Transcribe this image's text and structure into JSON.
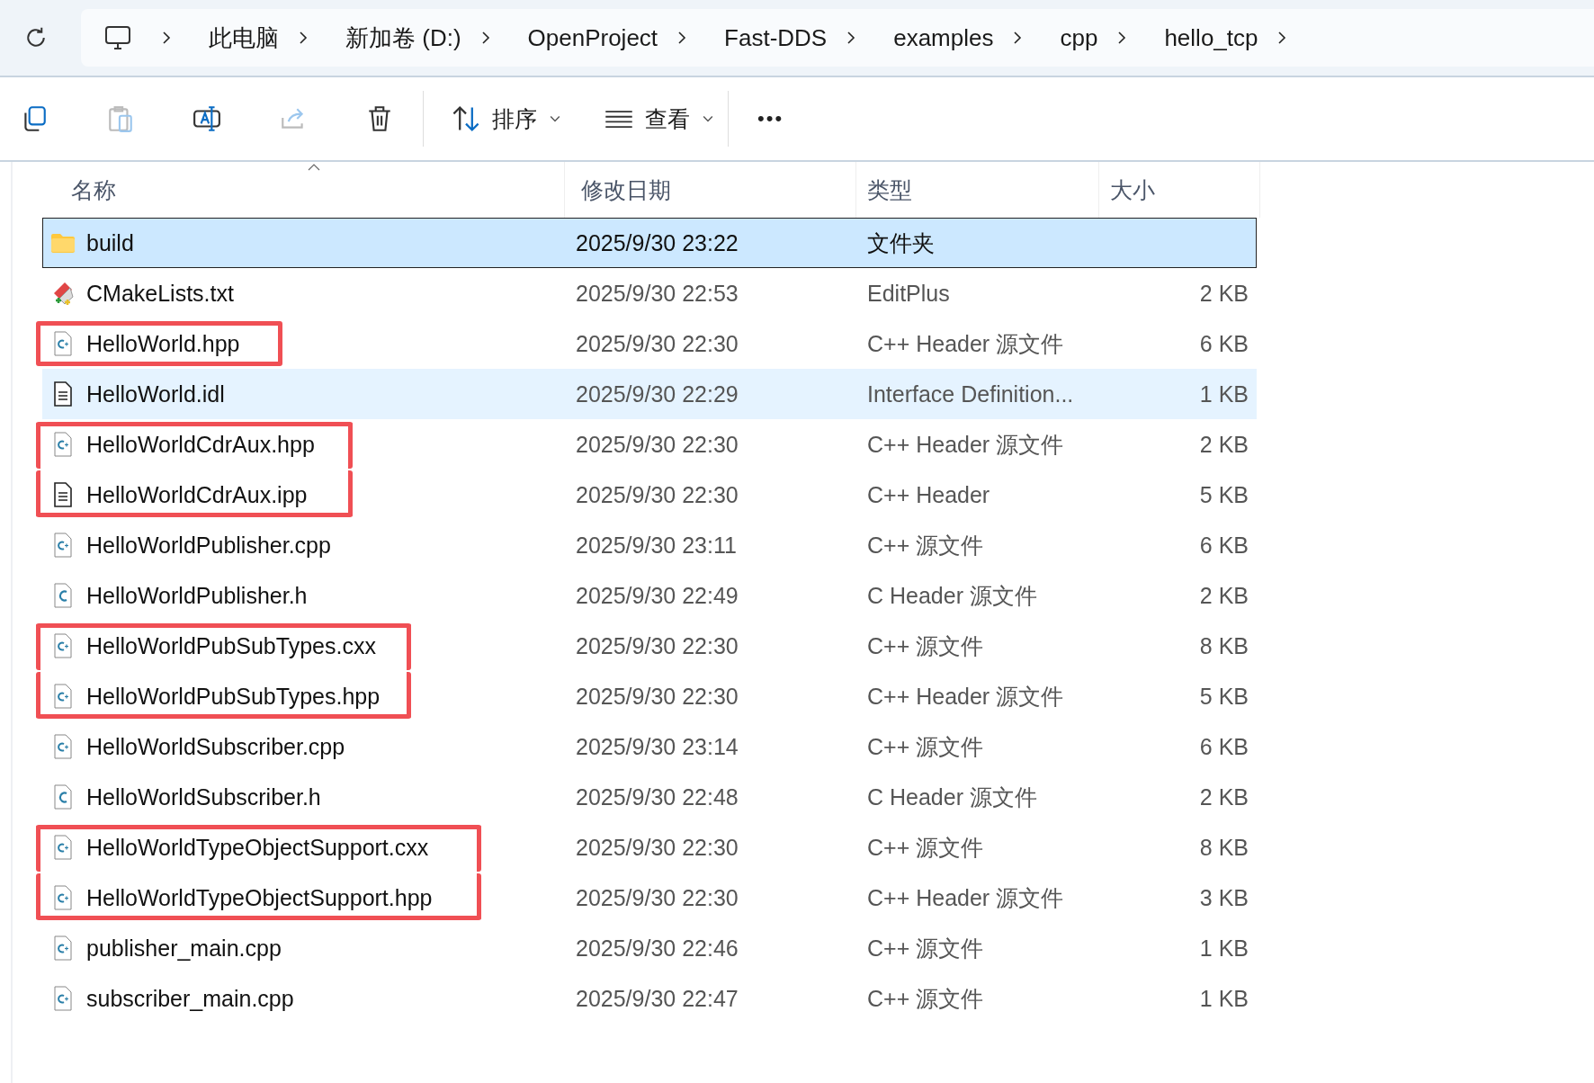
{
  "breadcrumb": [
    "此电脑",
    "新加卷 (D:)",
    "OpenProject",
    "Fast-DDS",
    "examples",
    "cpp",
    "hello_tcp"
  ],
  "toolbar": {
    "sort_label": "排序",
    "view_label": "查看",
    "more_label": "•••"
  },
  "columns": [
    "名称",
    "修改日期",
    "类型",
    "大小"
  ],
  "rows": [
    {
      "name": "build",
      "date": "2025/9/30 23:22",
      "type": "文件夹",
      "size": "",
      "kind": "folder",
      "selected": true,
      "hovered": false,
      "marked": false
    },
    {
      "name": "CMakeLists.txt",
      "date": "2025/9/30 22:53",
      "type": "EditPlus",
      "size": "2 KB",
      "kind": "editplus",
      "selected": false,
      "hovered": false,
      "marked": false
    },
    {
      "name": "HelloWorld.hpp",
      "date": "2025/9/30 22:30",
      "type": "C++ Header 源文件",
      "size": "6 KB",
      "kind": "cpp",
      "selected": false,
      "hovered": false,
      "marked": true
    },
    {
      "name": "HelloWorld.idl",
      "date": "2025/9/30 22:29",
      "type": "Interface Definition...",
      "size": "1 KB",
      "kind": "doc",
      "selected": false,
      "hovered": true,
      "marked": false
    },
    {
      "name": "HelloWorldCdrAux.hpp",
      "date": "2025/9/30 22:30",
      "type": "C++ Header 源文件",
      "size": "2 KB",
      "kind": "cpp",
      "selected": false,
      "hovered": false,
      "marked": true
    },
    {
      "name": "HelloWorldCdrAux.ipp",
      "date": "2025/9/30 22:30",
      "type": "C++ Header",
      "size": "5 KB",
      "kind": "doc",
      "selected": false,
      "hovered": false,
      "marked": true
    },
    {
      "name": "HelloWorldPublisher.cpp",
      "date": "2025/9/30 23:11",
      "type": "C++ 源文件",
      "size": "6 KB",
      "kind": "cpp",
      "selected": false,
      "hovered": false,
      "marked": false
    },
    {
      "name": "HelloWorldPublisher.h",
      "date": "2025/9/30 22:49",
      "type": "C Header 源文件",
      "size": "2 KB",
      "kind": "c",
      "selected": false,
      "hovered": false,
      "marked": false
    },
    {
      "name": "HelloWorldPubSubTypes.cxx",
      "date": "2025/9/30 22:30",
      "type": "C++ 源文件",
      "size": "8 KB",
      "kind": "cpp",
      "selected": false,
      "hovered": false,
      "marked": true
    },
    {
      "name": "HelloWorldPubSubTypes.hpp",
      "date": "2025/9/30 22:30",
      "type": "C++ Header 源文件",
      "size": "5 KB",
      "kind": "cpp",
      "selected": false,
      "hovered": false,
      "marked": true
    },
    {
      "name": "HelloWorldSubscriber.cpp",
      "date": "2025/9/30 23:14",
      "type": "C++ 源文件",
      "size": "6 KB",
      "kind": "cpp",
      "selected": false,
      "hovered": false,
      "marked": false
    },
    {
      "name": "HelloWorldSubscriber.h",
      "date": "2025/9/30 22:48",
      "type": "C Header 源文件",
      "size": "2 KB",
      "kind": "c",
      "selected": false,
      "hovered": false,
      "marked": false
    },
    {
      "name": "HelloWorldTypeObjectSupport.cxx",
      "date": "2025/9/30 22:30",
      "type": "C++ 源文件",
      "size": "8 KB",
      "kind": "cpp",
      "selected": false,
      "hovered": false,
      "marked": true
    },
    {
      "name": "HelloWorldTypeObjectSupport.hpp",
      "date": "2025/9/30 22:30",
      "type": "C++ Header 源文件",
      "size": "3 KB",
      "kind": "cpp",
      "selected": false,
      "hovered": false,
      "marked": true
    },
    {
      "name": "publisher_main.cpp",
      "date": "2025/9/30 22:46",
      "type": "C++ 源文件",
      "size": "1 KB",
      "kind": "cpp",
      "selected": false,
      "hovered": false,
      "marked": false
    },
    {
      "name": "subscriber_main.cpp",
      "date": "2025/9/30 22:47",
      "type": "C++ 源文件",
      "size": "1 KB",
      "kind": "cpp",
      "selected": false,
      "hovered": false,
      "marked": false
    }
  ]
}
